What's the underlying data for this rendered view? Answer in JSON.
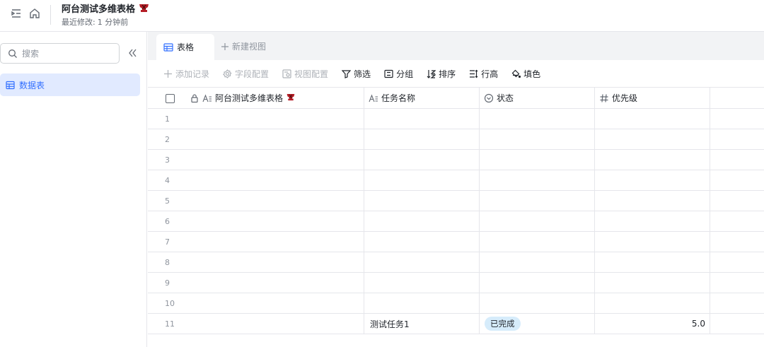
{
  "header": {
    "title": "阿台测试多维表格",
    "last_modified_label": "最近修改:",
    "last_modified_value": "1 分钟前"
  },
  "sidebar": {
    "search_placeholder": "搜索",
    "items": [
      {
        "label": "数据表",
        "icon": "table-icon"
      }
    ]
  },
  "tabs": {
    "active": "表格",
    "new_view": "新建视图"
  },
  "toolbar": {
    "add_record": "添加记录",
    "field_config": "字段配置",
    "view_config": "视图配置",
    "filter": "筛选",
    "group": "分组",
    "sort": "排序",
    "row_height": "行高",
    "fill_color": "填色"
  },
  "table": {
    "columns": [
      {
        "label": "阿台测试多维表格",
        "type_icon": "text-field-icon",
        "locked": true,
        "emoji": true
      },
      {
        "label": "任务名称",
        "type_icon": "text-field-icon"
      },
      {
        "label": "状态",
        "type_icon": "single-select-icon"
      },
      {
        "label": "优先级",
        "type_icon": "number-field-icon"
      }
    ],
    "rows": [
      {
        "n": "1",
        "task": "",
        "status": "",
        "priority": ""
      },
      {
        "n": "2",
        "task": "",
        "status": "",
        "priority": ""
      },
      {
        "n": "3",
        "task": "",
        "status": "",
        "priority": ""
      },
      {
        "n": "4",
        "task": "",
        "status": "",
        "priority": ""
      },
      {
        "n": "5",
        "task": "",
        "status": "",
        "priority": ""
      },
      {
        "n": "6",
        "task": "",
        "status": "",
        "priority": ""
      },
      {
        "n": "7",
        "task": "",
        "status": "",
        "priority": ""
      },
      {
        "n": "8",
        "task": "",
        "status": "",
        "priority": ""
      },
      {
        "n": "9",
        "task": "",
        "status": "",
        "priority": ""
      },
      {
        "n": "10",
        "task": "",
        "status": "",
        "priority": ""
      },
      {
        "n": "11",
        "task": "测试任务1",
        "status": "已完成",
        "priority": "5.0"
      }
    ]
  },
  "colors": {
    "accent": "#3370ff",
    "selected_bg": "#e1eaff",
    "status_tag_bg": "#d6ecfb",
    "border": "#e5e6eb"
  }
}
